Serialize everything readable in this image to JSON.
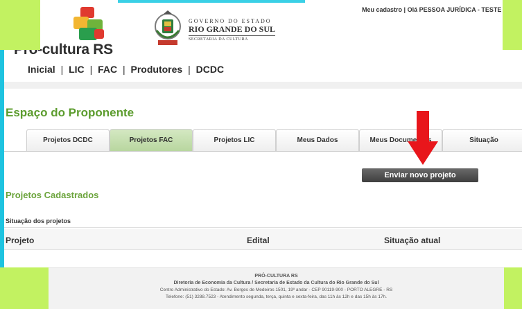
{
  "header": {
    "brand": "Pró-cultura RS",
    "gov_line1": "GOVERNO DO ESTADO",
    "gov_line2": "RIO GRANDE DO SUL",
    "gov_line3": "SECRETARIA DA CULTURA",
    "user_link_account": "Meu cadastro",
    "user_separator": " | ",
    "user_greeting": "Olá PESSOA JURÍDICA - TESTE |"
  },
  "topnav": {
    "items": [
      "Inicial",
      "LIC",
      "FAC",
      "Produtores",
      "DCDC"
    ],
    "separator": "|"
  },
  "main": {
    "page_title": "Espaço do Proponente",
    "tabs": [
      "Projetos DCDC",
      "Projetos FAC",
      "Projetos LIC",
      "Meus Dados",
      "Meus Documentos",
      "Situação"
    ],
    "active_tab": "Projetos FAC",
    "send_button": "Enviar novo projeto",
    "section_title": "Projetos Cadastrados",
    "sub_label": "Situação dos projetos",
    "table_headers": [
      "Projeto",
      "Edital",
      "Situação atual"
    ]
  },
  "footer": {
    "line1": "PRÓ-CULTURA RS",
    "line2": "Diretoria de Economia da Cultura / Secretaria de Estado da Cultura do Rio Grande do Sul",
    "line3": "Centro Administrativo do Estado: Av. Borges de Medeiros 1501, 19º andar - CEP 90119-900 - PORTO ALEGRE - RS",
    "line4": "Telefone: (51) 3288.7523 - Atendimento segunda, terça, quinta e sexta-feira, das 11h às 12h e das 15h às 17h."
  },
  "colors": {
    "accent_green": "#5c9c2e",
    "arrow_red": "#e8161b",
    "frame_green": "#c2f261",
    "frame_cyan": "#1ec3e0"
  },
  "icons": {
    "arrow": "red-down-arrow-icon",
    "crest": "state-crest-icon",
    "logo": "pro-cultura-logo-icon"
  }
}
